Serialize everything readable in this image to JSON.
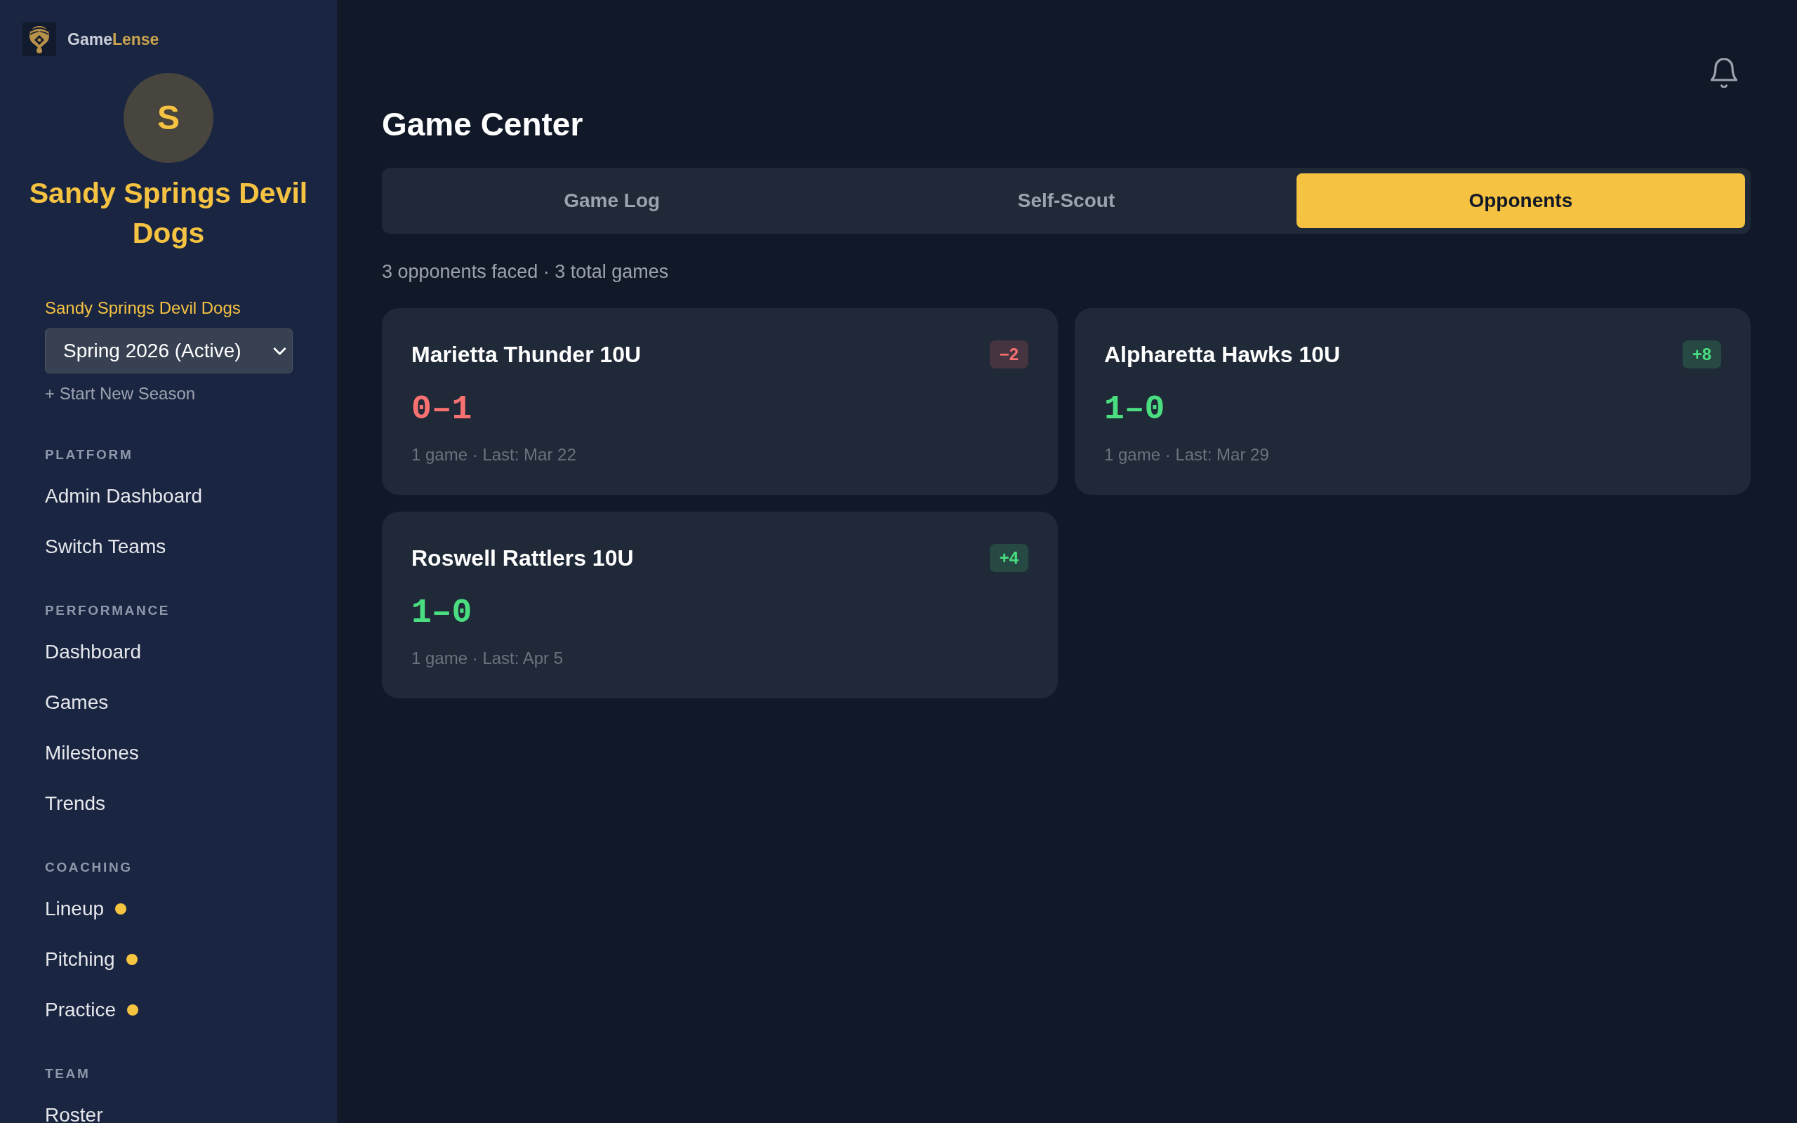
{
  "brand": {
    "primary": "Game",
    "accent": "Lense"
  },
  "sidebar": {
    "team": {
      "initial": "S",
      "name": "Sandy Springs Devil Dogs"
    },
    "season": {
      "label": "Sandy Springs Devil Dogs",
      "value": "Spring 2026 (Active)",
      "action": "+ Start New Season"
    },
    "sections": [
      {
        "title": "PLATFORM",
        "items": [
          {
            "label": "Admin Dashboard",
            "alert": false
          },
          {
            "label": "Switch Teams",
            "alert": false
          }
        ]
      },
      {
        "title": "PERFORMANCE",
        "items": [
          {
            "label": "Dashboard",
            "alert": false
          },
          {
            "label": "Games",
            "alert": false
          },
          {
            "label": "Milestones",
            "alert": false
          },
          {
            "label": "Trends",
            "alert": false
          }
        ]
      },
      {
        "title": "COACHING",
        "items": [
          {
            "label": "Lineup",
            "alert": true
          },
          {
            "label": "Pitching",
            "alert": true
          },
          {
            "label": "Practice",
            "alert": true
          }
        ]
      },
      {
        "title": "TEAM",
        "items": [
          {
            "label": "Roster",
            "alert": false
          }
        ]
      }
    ]
  },
  "main": {
    "title": "Game Center",
    "tabs": [
      {
        "label": "Game Log",
        "selected": false
      },
      {
        "label": "Self-Scout",
        "selected": false
      },
      {
        "label": "Opponents",
        "selected": true
      }
    ],
    "summary": "3 opponents faced · 3 total games",
    "opponents": [
      {
        "name": "Marietta Thunder 10U",
        "differential": "−2",
        "record": "0–1",
        "color": "#f87171",
        "meta": "1 game · Last: Mar 22"
      },
      {
        "name": "Alpharetta Hawks 10U",
        "differential": "+8",
        "record": "1–0",
        "color": "#4ade80",
        "meta": "1 game · Last: Mar 29"
      },
      {
        "name": "Roswell Rattlers 10U",
        "differential": "+4",
        "record": "1–0",
        "color": "#4ade80",
        "meta": "1 game · Last: Apr 5"
      }
    ]
  }
}
